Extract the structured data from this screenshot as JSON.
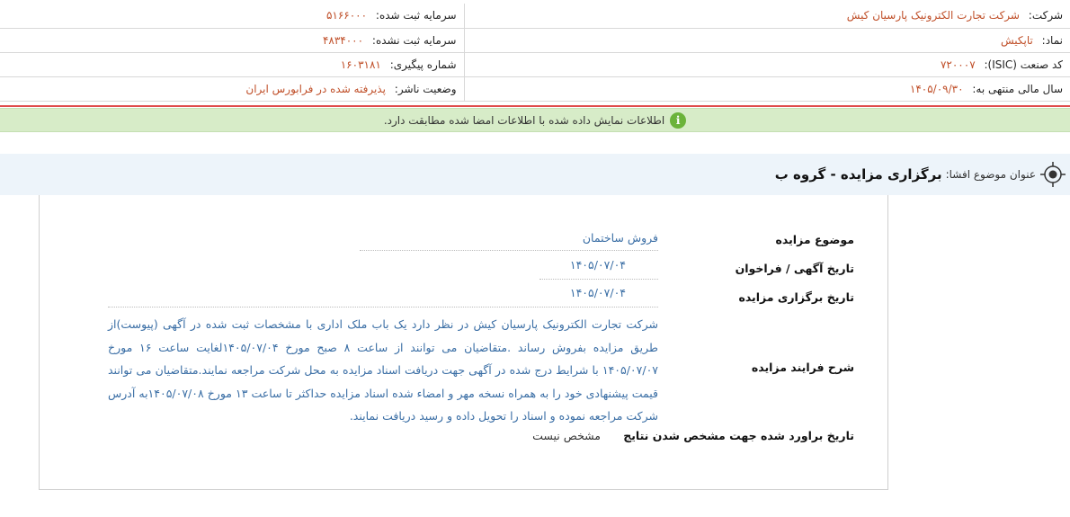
{
  "company_info": {
    "company_label": "شرکت:",
    "company_value": "شرکت تجارت الکترونیک پارسیان کیش",
    "symbol_label": "نماد:",
    "symbol_value": "تاپکیش",
    "isic_label": "کد صنعت (ISIC):",
    "isic_value": "۷۲۰۰۰۷",
    "fiscal_label": "سال مالی منتهی به:",
    "fiscal_value": "۱۴۰۵/۰۹/۳۰",
    "reg_capital_label": "سرمایه ثبت شده:",
    "reg_capital_value": "۵۱۶۶۰۰۰",
    "unreg_capital_label": "سرمایه ثبت نشده:",
    "unreg_capital_value": "۴۸۳۴۰۰۰",
    "tracking_label": "شماره پیگیری:",
    "tracking_value": "۱۶۰۳۱۸۱",
    "status_label": "وضعیت ناشر:",
    "status_value": "پذیرفته شده در فرابورس ایران"
  },
  "notice": {
    "text": "اطلاعات نمایش داده شده با اطلاعات امضا شده مطابقت دارد.",
    "icon": "info-icon",
    "bg_color": "#d7ecc8",
    "icon_color": "#6bb33a"
  },
  "subject": {
    "label": "عنوان موضوع افشا:",
    "title": "برگزاری مزایده - گروه ب",
    "icon": "target-icon"
  },
  "auction": {
    "topic_label": "موضوع مزایده",
    "topic_value": "فروش ساختمان",
    "ad_date_label": "تاریخ آگهی / فراخوان",
    "ad_date_value": "۱۴۰۵/۰۷/۰۴",
    "hold_date_label": "تاریخ برگزاری مزایده",
    "hold_date_value": "۱۴۰۵/۰۷/۰۴",
    "process_label": "شرح فرایند مزایده",
    "process_value": "شرکت تجارت الکترونیک پارسیان کیش در نظر دارد یک باب ملک اداری با مشخصات ثبت شده در آگهی (پیوست)از طریق مزایده بفروش رساند .متقاضیان می توانند از ساعت ۸ صبح مورخ ۱۴۰۵/۰۷/۰۴لغایت ساعت ۱۶ مورخ ۱۴۰۵/۰۷/۰۷ با شرایط درج شده در آگهی جهت دریافت اسناد مزایده به محل شرکت مراجعه نمایند.متقاضیان می توانند قیمت پیشنهادی خود را به همراه نسخه مهر و امضاء شده اسناد مزایده حداکثر تا ساعت ۱۳ مورخ ۱۴۰۵/۰۷/۰۸به آدرس شرکت مراجعه نموده و اسناد را تحویل داده و رسید دریافت نمایند.",
    "result_date_label": "تاریخ براورد شده جهت مشخص شدن نتایج",
    "result_date_value": "مشخص نیست"
  },
  "colors": {
    "value_orange": "#c0502a",
    "value_blue": "#3a6ea5",
    "separator_red": "#e04b4b",
    "subject_bar_bg": "#edf4fa"
  }
}
